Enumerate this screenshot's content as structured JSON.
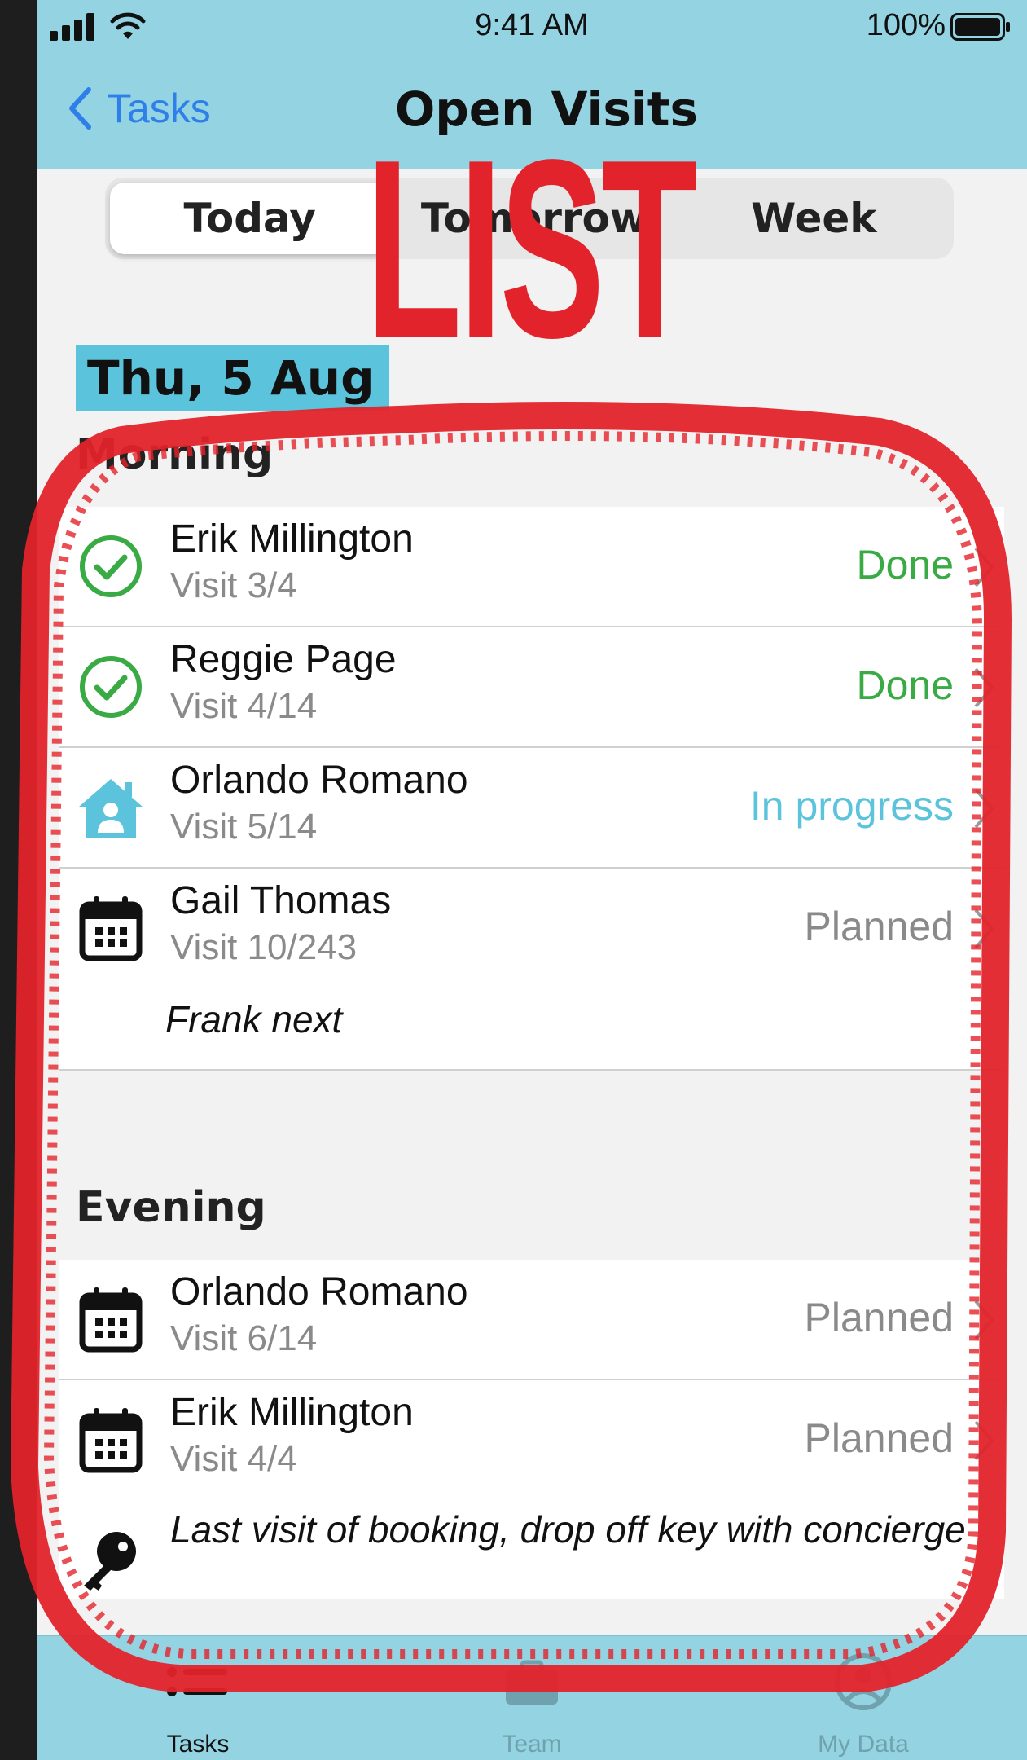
{
  "status_bar": {
    "time": "9:41 AM",
    "battery": "100%"
  },
  "nav": {
    "back_label": "Tasks",
    "title": "Open Visits"
  },
  "segments": [
    "Today",
    "Tomorrow",
    "Week"
  ],
  "date_header": "Thu, 5 Aug",
  "sections": {
    "morning": {
      "label": "Morning",
      "rows": [
        {
          "name": "Erik Millington",
          "visit": "Visit 3/4",
          "status": "Done",
          "icon": "check-circle-icon"
        },
        {
          "name": "Reggie Page",
          "visit": "Visit 4/14",
          "status": "Done",
          "icon": "check-circle-icon"
        },
        {
          "name": "Orlando Romano",
          "visit": "Visit 5/14",
          "status": "In progress",
          "icon": "home-person-icon"
        },
        {
          "name": "Gail Thomas",
          "visit": "Visit 10/243",
          "status": "Planned",
          "icon": "calendar-icon",
          "note": "Frank next"
        }
      ]
    },
    "evening": {
      "label": "Evening",
      "rows": [
        {
          "name": "Orlando Romano",
          "visit": "Visit 6/14",
          "status": "Planned",
          "icon": "calendar-icon"
        },
        {
          "name": "Erik Millington",
          "visit": "Visit 4/4",
          "status": "Planned",
          "icon": "calendar-icon",
          "note": "Last visit of booking, drop off key with concierge"
        }
      ]
    }
  },
  "tabs": [
    {
      "label": "Tasks",
      "icon": "list-icon"
    },
    {
      "label": "Team",
      "icon": "briefcase-icon"
    },
    {
      "label": "My Data",
      "icon": "user-circle-icon"
    }
  ],
  "overlay": {
    "word": "LIST",
    "color": "#e3232b"
  },
  "colors": {
    "header": "#94d3e2",
    "done": "#3aaa45",
    "in_progress": "#5bc4dc",
    "planned": "#8a8a8a",
    "accent": "#2f7fe8"
  }
}
